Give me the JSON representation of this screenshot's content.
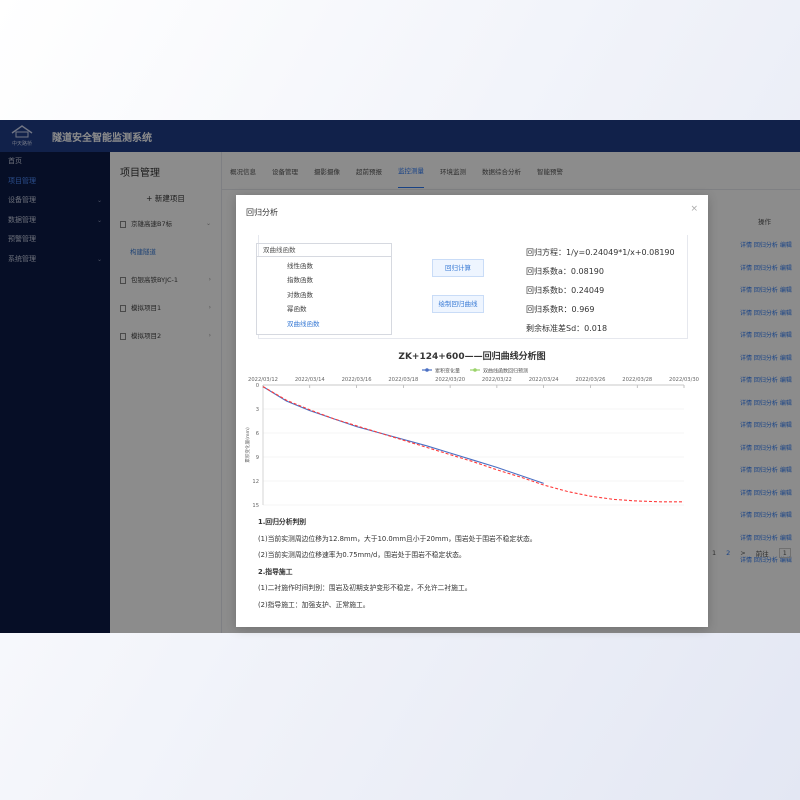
{
  "app": {
    "title": "隧道安全智能监测系统",
    "logo_text": "中天路桥",
    "colors": {
      "header": "#1f3c88",
      "sidebar": "#0b1a45",
      "accent": "#2f7bf5"
    }
  },
  "sidebar": {
    "items": [
      {
        "label": "首页",
        "has_arrow": false,
        "active": false
      },
      {
        "label": "项目管理",
        "has_arrow": false,
        "active": true
      },
      {
        "label": "设备管理",
        "has_arrow": true,
        "active": false
      },
      {
        "label": "数据管理",
        "has_arrow": true,
        "active": false
      },
      {
        "label": "预警管理",
        "has_arrow": false,
        "active": false
      },
      {
        "label": "系统管理",
        "has_arrow": true,
        "active": false
      }
    ]
  },
  "project_panel": {
    "title": "项目管理",
    "new_button": "+ 新建项目",
    "items": [
      {
        "label": "京雄高速B7标"
      },
      {
        "label": "包银高铁BYJC-1"
      },
      {
        "label": "模拟项目1"
      },
      {
        "label": "模拟项目2"
      }
    ],
    "sub_item": "构建隧道"
  },
  "tabs": [
    {
      "label": "概况信息",
      "active": false
    },
    {
      "label": "设备管理",
      "active": false
    },
    {
      "label": "摄影摄像",
      "active": false
    },
    {
      "label": "超前预报",
      "active": false
    },
    {
      "label": "监控测量",
      "active": true
    },
    {
      "label": "环境监测",
      "active": false
    },
    {
      "label": "数据综合分析",
      "active": false
    },
    {
      "label": "智能预警",
      "active": false
    }
  ],
  "table": {
    "ops_header": "操作",
    "row_ops": "详情 回归分析 编辑"
  },
  "pager": {
    "pages": [
      "1",
      "2"
    ],
    "current": "2",
    "next": ">",
    "goto_label": "前往",
    "goto_value": "1"
  },
  "modal": {
    "title": "回归分析",
    "close": "×",
    "dropdown_value": "双曲线函数",
    "dropdown_options": [
      "线性函数",
      "指数函数",
      "对数函数",
      "幂函数",
      "双曲线函数"
    ],
    "selected_option": "双曲线函数",
    "btn_compute": "回归计算",
    "btn_plot": "绘制回归曲线",
    "results": [
      "回归方程：1/y=0.24049*1/x+0.08190",
      "回归系数a：0.08190",
      "回归系数b：0.24049",
      "回归系数R：0.969",
      "剩余标准差Sd：0.018"
    ],
    "analysis": [
      {
        "text": "1.回归分析判别",
        "bold": true
      },
      {
        "text": "(1)当前实测周边位移为12.8mm，大于10.0mm且小于20mm，围岩处于围岩不稳定状态。",
        "bold": false
      },
      {
        "text": "(2)当前实测周边位移速率为0.75mm/d，围岩处于围岩不稳定状态。",
        "bold": false
      },
      {
        "text": "2.指导施工",
        "bold": true
      },
      {
        "text": "(1)二衬施作时间判别：围岩及初期支护变形不稳定，不允许二衬施工。",
        "bold": false
      },
      {
        "text": "(2)指导施工：加强支护、正常施工。",
        "bold": false
      }
    ]
  },
  "chart_data": {
    "type": "line",
    "title": "ZK+124+600——回归曲线分析图",
    "ylabel": "累积变化量(mm)",
    "x_ticks": [
      "2022/03/12",
      "2022/03/14",
      "2022/03/16",
      "2022/03/18",
      "2022/03/20",
      "2022/03/22",
      "2022/03/24",
      "2022/03/26",
      "2022/03/28",
      "2022/03/30"
    ],
    "x_range": [
      12,
      30
    ],
    "y_ticks": [
      0,
      3,
      6,
      9,
      12,
      15
    ],
    "y_range": [
      0,
      15
    ],
    "y_inverted": true,
    "legend_position": "top-center",
    "series": [
      {
        "name": "累积变化量",
        "color": "#4a6fc3",
        "style": "solid",
        "x": [
          12,
          13,
          14,
          15,
          16,
          17,
          18,
          19,
          20,
          21,
          22,
          23,
          24
        ],
        "y": [
          0.2,
          2.0,
          3.2,
          4.2,
          5.2,
          6.0,
          6.8,
          7.6,
          8.5,
          9.4,
          10.3,
          11.3,
          12.3
        ]
      },
      {
        "name": "双曲线函数回归预测",
        "color": "#ff3b3b",
        "style": "dashed",
        "x": [
          12,
          13,
          14,
          15,
          16,
          17,
          18,
          19,
          20,
          21,
          22,
          23,
          24,
          25,
          26,
          27,
          28,
          29,
          30
        ],
        "y": [
          0.2,
          1.9,
          3.1,
          4.2,
          5.1,
          6.0,
          6.9,
          7.8,
          8.7,
          9.6,
          10.6,
          11.5,
          12.5,
          13.3,
          13.9,
          14.3,
          14.5,
          14.6,
          14.6
        ]
      }
    ]
  }
}
